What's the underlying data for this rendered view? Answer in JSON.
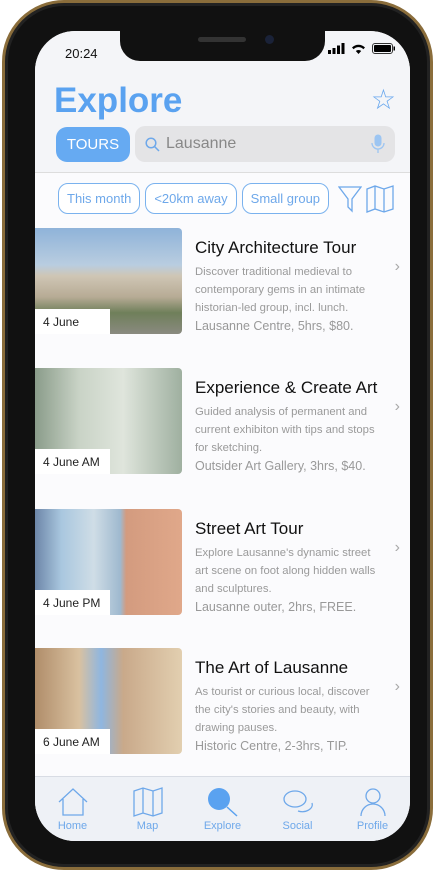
{
  "status": {
    "time": "20:24"
  },
  "header": {
    "title": "Explore",
    "tours_label": "TOURS",
    "search_value": "Lausanne"
  },
  "filters": [
    "This month",
    "<20km away",
    "Small group"
  ],
  "tours": [
    {
      "title": "City Architecture Tour",
      "description": "Discover traditional medieval to contemporary gems in an intimate historian-led group, incl. lunch.",
      "meta": "Lausanne Centre, 5hrs, $80.",
      "date": "4 June"
    },
    {
      "title": "Experience & Create Art",
      "description": "Guided analysis of permanent and current exhibiton with tips and stops for sketching.",
      "meta": "Outsider Art Gallery, 3hrs, $40.",
      "date": "4 June AM"
    },
    {
      "title": "Street Art Tour",
      "description": "Explore Lausanne's dynamic street art scene on foot along hidden walls and sculptures.",
      "meta": "Lausanne outer, 2hrs, FREE.",
      "date": "4 June PM"
    },
    {
      "title": "The Art of Lausanne",
      "description": "As tourist or curious local, discover the city's stories and beauty, with drawing pauses.",
      "meta": "Historic Centre, 2-3hrs, TIP.",
      "date": "6 June AM"
    }
  ],
  "tabbar": [
    "Home",
    "Map",
    "Explore",
    "Social",
    "Profile"
  ],
  "colors": {
    "accent": "#5aa2f0"
  }
}
